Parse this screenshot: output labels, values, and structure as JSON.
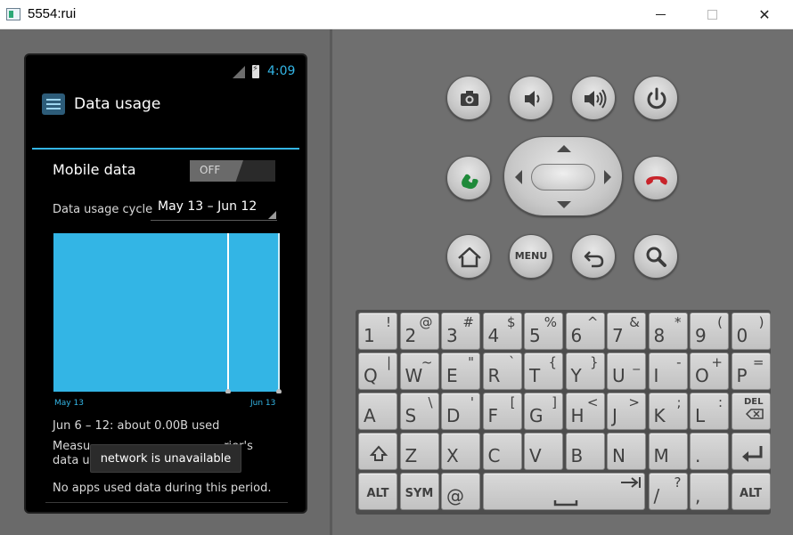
{
  "window": {
    "title": "5554:rui"
  },
  "status": {
    "time": "4:09"
  },
  "screen": {
    "title": "Data usage",
    "mobile_data_label": "Mobile data",
    "mobile_data_state": "OFF",
    "cycle_label": "Data usage cycle",
    "cycle_value": "May 13 – Jun 12",
    "chart": {
      "start_label": "May 13",
      "end_label": "Jun 13"
    },
    "usage_summary": "Jun 6 – 12: about 0.00B used",
    "measure_note_start": "Measu",
    "measure_note_end": "rier's",
    "measure_note_line2": "data us",
    "no_apps_text": "No apps used data during this period.",
    "toast": "network is unavailable"
  },
  "hardware": {
    "buttons": [
      {
        "name": "camera-button",
        "icon": "camera-icon"
      },
      {
        "name": "volume-down-button",
        "icon": "volume-down-icon"
      },
      {
        "name": "volume-up-button",
        "icon": "volume-up-icon"
      },
      {
        "name": "power-button",
        "icon": "power-icon"
      },
      {
        "name": "call-button",
        "icon": "phone-icon"
      },
      {
        "name": "end-call-button",
        "icon": "phone-hangup-icon"
      },
      {
        "name": "home-button",
        "icon": "home-icon"
      },
      {
        "name": "menu-button",
        "label": "MENU"
      },
      {
        "name": "back-button",
        "icon": "back-icon"
      },
      {
        "name": "search-button",
        "icon": "search-icon"
      }
    ],
    "menu_label": "MENU"
  },
  "keyboard": {
    "rows": [
      [
        {
          "m": "1",
          "a": "!"
        },
        {
          "m": "2",
          "a": "@"
        },
        {
          "m": "3",
          "a": "#"
        },
        {
          "m": "4",
          "a": "$"
        },
        {
          "m": "5",
          "a": "%"
        },
        {
          "m": "6",
          "a": "^"
        },
        {
          "m": "7",
          "a": "&"
        },
        {
          "m": "8",
          "a": "*"
        },
        {
          "m": "9",
          "a": "("
        },
        {
          "m": "0",
          "a": ")"
        }
      ],
      [
        {
          "m": "Q",
          "a": "|"
        },
        {
          "m": "W",
          "a": "~"
        },
        {
          "m": "E",
          "a": "\""
        },
        {
          "m": "R",
          "a": "`"
        },
        {
          "m": "T",
          "a": "{"
        },
        {
          "m": "Y",
          "a": "}"
        },
        {
          "m": "U",
          "a": "_"
        },
        {
          "m": "I",
          "a": "-"
        },
        {
          "m": "O",
          "a": "+"
        },
        {
          "m": "P",
          "a": "="
        }
      ],
      [
        {
          "m": "A",
          "a": ""
        },
        {
          "m": "S",
          "a": "\\"
        },
        {
          "m": "D",
          "a": "'"
        },
        {
          "m": "F",
          "a": "["
        },
        {
          "m": "G",
          "a": "]"
        },
        {
          "m": "H",
          "a": "<"
        },
        {
          "m": "J",
          "a": ">"
        },
        {
          "m": "K",
          "a": ";"
        },
        {
          "m": "L",
          "a": ":"
        },
        {
          "m": "DEL",
          "a": ""
        }
      ],
      [
        {
          "m": "shift",
          "a": ""
        },
        {
          "m": "Z",
          "a": ""
        },
        {
          "m": "X",
          "a": ""
        },
        {
          "m": "C",
          "a": ""
        },
        {
          "m": "V",
          "a": ""
        },
        {
          "m": "B",
          "a": ""
        },
        {
          "m": "N",
          "a": ""
        },
        {
          "m": "M",
          "a": ""
        },
        {
          "m": ".",
          "a": ""
        },
        {
          "m": "enter",
          "a": ""
        }
      ]
    ],
    "bottom": {
      "alt_left": "ALT",
      "sym": "SYM",
      "at": "@",
      "slash": "/",
      "slash_alt": "?",
      "comma": ",",
      "alt_right": "ALT"
    },
    "del_label": "DEL"
  },
  "colors": {
    "accent": "#33b5e5",
    "chart_fill": "#33b5e5",
    "emulator_bg": "#6f6f6f"
  }
}
